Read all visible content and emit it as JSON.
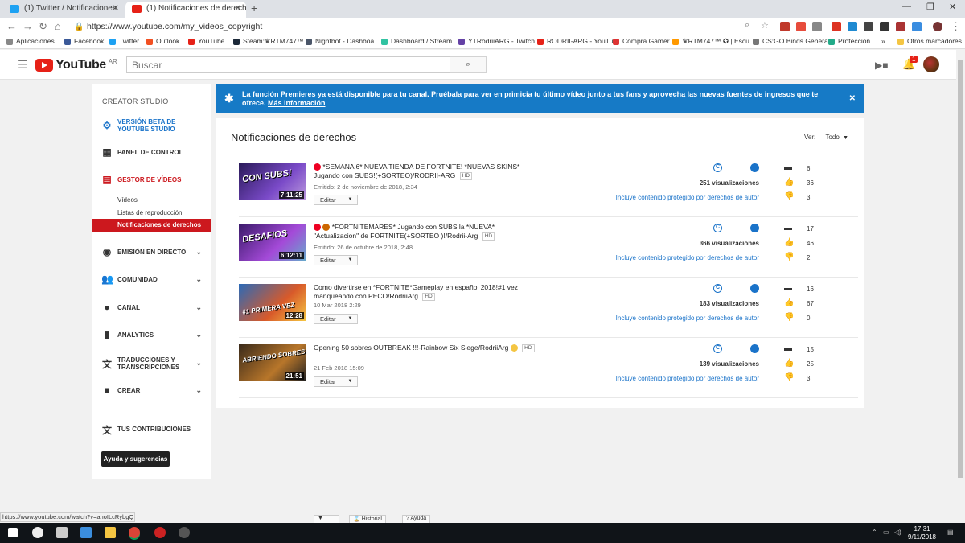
{
  "browser": {
    "tabs": [
      {
        "label": "(1) Twitter / Notificaciones",
        "color": "#1da1f2"
      },
      {
        "label": "(1) Notificaciones de derechos -",
        "color": "#e62117"
      }
    ],
    "url": "https://www.youtube.com/my_videos_copyright",
    "bookmarks": [
      {
        "label": "Aplicaciones",
        "color": "#888"
      },
      {
        "label": "Facebook",
        "color": "#3b5998"
      },
      {
        "label": "Twitter",
        "color": "#1da1f2"
      },
      {
        "label": "Outlook",
        "color": "#f25022"
      },
      {
        "label": "YouTube",
        "color": "#e62117"
      },
      {
        "label": "Steam:♛RTM747™",
        "color": "#1b2838"
      },
      {
        "label": "Nightbot - Dashboa",
        "color": "#4a5568"
      },
      {
        "label": "Dashboard / Stream",
        "color": "#31c3a2"
      },
      {
        "label": "YTRodriiARG - Twitch",
        "color": "#6441a5"
      },
      {
        "label": "RODRII-ARG - YouTu",
        "color": "#e62117"
      },
      {
        "label": "Compra Gamer",
        "color": "#d33"
      },
      {
        "label": "♛RTM747™ ✪ | Escu",
        "color": "#f90"
      },
      {
        "label": "CS:GO Binds Generat",
        "color": "#777"
      },
      {
        "label": "Protección",
        "color": "#2a8"
      }
    ],
    "other_bookmarks": "Otros marcadores",
    "status_url": "https://www.youtube.com/watch?v=ahoILcRybgQ"
  },
  "header": {
    "logo": "YouTube",
    "country": "AR",
    "search_placeholder": "Buscar",
    "notif_count": "1"
  },
  "sidebar": {
    "title": "CREATOR STUDIO",
    "beta": "VERSIÓN BETA DE YOUTUBE STUDIO",
    "panel": "PANEL DE CONTROL",
    "gestor": "GESTOR DE VÍDEOS",
    "sub_videos": "Vídeos",
    "sub_listas": "Listas de reproducción",
    "sub_notif": "Notificaciones de derechos",
    "emision": "EMISIÓN EN DIRECTO",
    "comunidad": "COMUNIDAD",
    "canal": "CANAL",
    "analytics": "ANALYTICS",
    "traducciones": "TRADUCCIONES Y TRANSCRIPCIONES",
    "crear": "CREAR",
    "contrib": "TUS CONTRIBUCIONES",
    "help": "Ayuda y sugerencias"
  },
  "banner": {
    "text": "La función Premieres ya está disponible para tu canal. Pruébala para ver en primicia tu último vídeo junto a tus fans y aprovecha las nuevas fuentes de ingresos que te ofrece.",
    "link": "Más información"
  },
  "main": {
    "title": "Notificaciones de derechos",
    "ver_label": "Ver:",
    "ver_value": "Todo",
    "edit_label": "Editar",
    "hd": "HD",
    "claim": "Incluye contenido protegido por derechos de autor",
    "videos": [
      {
        "title": "*SEMANA 6* NUEVA TIENDA DE FORTNITE! *NUEVAS SKINS* Jugando con SUBS!(+SORTEO)/RODRII-ARG",
        "date": "Emitido: 2 de noviembre de 2018, 2:34",
        "duration": "7:11:25",
        "thumb_text": "CON SUBS!",
        "views": "251 visualizaciones",
        "comments": "6",
        "likes": "36",
        "dislikes": "3",
        "thumb_color": "#5a3a8a"
      },
      {
        "title": "*FORTNITEMARES* Jugando con SUBS la *NUEVA* \"Actualizacion\" de FORTNITE(+SORTEO )!/Rodrii-Arg",
        "date": "Emitido: 26 de octubre de 2018, 2:48",
        "duration": "6:12:11",
        "thumb_text": "DESAFIOS",
        "views": "366 visualizaciones",
        "comments": "17",
        "likes": "46",
        "dislikes": "2",
        "thumb_color": "#7a3a9a"
      },
      {
        "title": "Como divertirse en *FORTNITE*Gameplay en español 2018!#1 vez manqueando con PECO/RodriiArg",
        "date": "10 Mar 2018 2:29",
        "duration": "12:28",
        "thumb_text": "#1 PRIMERA VEZ",
        "views": "183 visualizaciones",
        "comments": "16",
        "likes": "67",
        "dislikes": "0",
        "thumb_color": "#3a7ab8"
      },
      {
        "title": "Opening 50 sobres OUTBREAK !!!-Rainbow Six Siege/RodriiArg",
        "date": "21 Feb 2018 15:09",
        "duration": "21:51",
        "thumb_text": "ABRIENDO SOBRES",
        "views": "139 visualizaciones",
        "comments": "15",
        "likes": "25",
        "dislikes": "3",
        "thumb_color": "#8a5a2a"
      }
    ]
  },
  "footer": {
    "historial": "Historial",
    "ayuda": "Ayuda"
  },
  "taskbar": {
    "time": "17:31",
    "date": "9/11/2018"
  }
}
